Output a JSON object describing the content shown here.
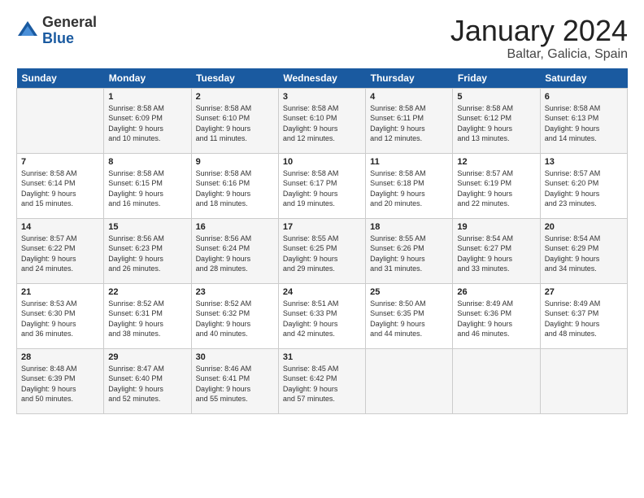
{
  "logo": {
    "general": "General",
    "blue": "Blue"
  },
  "title": "January 2024",
  "location": "Baltar, Galicia, Spain",
  "days_of_week": [
    "Sunday",
    "Monday",
    "Tuesday",
    "Wednesday",
    "Thursday",
    "Friday",
    "Saturday"
  ],
  "weeks": [
    [
      {
        "day": "",
        "info": ""
      },
      {
        "day": "1",
        "info": "Sunrise: 8:58 AM\nSunset: 6:09 PM\nDaylight: 9 hours\nand 10 minutes."
      },
      {
        "day": "2",
        "info": "Sunrise: 8:58 AM\nSunset: 6:10 PM\nDaylight: 9 hours\nand 11 minutes."
      },
      {
        "day": "3",
        "info": "Sunrise: 8:58 AM\nSunset: 6:10 PM\nDaylight: 9 hours\nand 12 minutes."
      },
      {
        "day": "4",
        "info": "Sunrise: 8:58 AM\nSunset: 6:11 PM\nDaylight: 9 hours\nand 12 minutes."
      },
      {
        "day": "5",
        "info": "Sunrise: 8:58 AM\nSunset: 6:12 PM\nDaylight: 9 hours\nand 13 minutes."
      },
      {
        "day": "6",
        "info": "Sunrise: 8:58 AM\nSunset: 6:13 PM\nDaylight: 9 hours\nand 14 minutes."
      }
    ],
    [
      {
        "day": "7",
        "info": "Sunrise: 8:58 AM\nSunset: 6:14 PM\nDaylight: 9 hours\nand 15 minutes."
      },
      {
        "day": "8",
        "info": "Sunrise: 8:58 AM\nSunset: 6:15 PM\nDaylight: 9 hours\nand 16 minutes."
      },
      {
        "day": "9",
        "info": "Sunrise: 8:58 AM\nSunset: 6:16 PM\nDaylight: 9 hours\nand 18 minutes."
      },
      {
        "day": "10",
        "info": "Sunrise: 8:58 AM\nSunset: 6:17 PM\nDaylight: 9 hours\nand 19 minutes."
      },
      {
        "day": "11",
        "info": "Sunrise: 8:58 AM\nSunset: 6:18 PM\nDaylight: 9 hours\nand 20 minutes."
      },
      {
        "day": "12",
        "info": "Sunrise: 8:57 AM\nSunset: 6:19 PM\nDaylight: 9 hours\nand 22 minutes."
      },
      {
        "day": "13",
        "info": "Sunrise: 8:57 AM\nSunset: 6:20 PM\nDaylight: 9 hours\nand 23 minutes."
      }
    ],
    [
      {
        "day": "14",
        "info": "Sunrise: 8:57 AM\nSunset: 6:22 PM\nDaylight: 9 hours\nand 24 minutes."
      },
      {
        "day": "15",
        "info": "Sunrise: 8:56 AM\nSunset: 6:23 PM\nDaylight: 9 hours\nand 26 minutes."
      },
      {
        "day": "16",
        "info": "Sunrise: 8:56 AM\nSunset: 6:24 PM\nDaylight: 9 hours\nand 28 minutes."
      },
      {
        "day": "17",
        "info": "Sunrise: 8:55 AM\nSunset: 6:25 PM\nDaylight: 9 hours\nand 29 minutes."
      },
      {
        "day": "18",
        "info": "Sunrise: 8:55 AM\nSunset: 6:26 PM\nDaylight: 9 hours\nand 31 minutes."
      },
      {
        "day": "19",
        "info": "Sunrise: 8:54 AM\nSunset: 6:27 PM\nDaylight: 9 hours\nand 33 minutes."
      },
      {
        "day": "20",
        "info": "Sunrise: 8:54 AM\nSunset: 6:29 PM\nDaylight: 9 hours\nand 34 minutes."
      }
    ],
    [
      {
        "day": "21",
        "info": "Sunrise: 8:53 AM\nSunset: 6:30 PM\nDaylight: 9 hours\nand 36 minutes."
      },
      {
        "day": "22",
        "info": "Sunrise: 8:52 AM\nSunset: 6:31 PM\nDaylight: 9 hours\nand 38 minutes."
      },
      {
        "day": "23",
        "info": "Sunrise: 8:52 AM\nSunset: 6:32 PM\nDaylight: 9 hours\nand 40 minutes."
      },
      {
        "day": "24",
        "info": "Sunrise: 8:51 AM\nSunset: 6:33 PM\nDaylight: 9 hours\nand 42 minutes."
      },
      {
        "day": "25",
        "info": "Sunrise: 8:50 AM\nSunset: 6:35 PM\nDaylight: 9 hours\nand 44 minutes."
      },
      {
        "day": "26",
        "info": "Sunrise: 8:49 AM\nSunset: 6:36 PM\nDaylight: 9 hours\nand 46 minutes."
      },
      {
        "day": "27",
        "info": "Sunrise: 8:49 AM\nSunset: 6:37 PM\nDaylight: 9 hours\nand 48 minutes."
      }
    ],
    [
      {
        "day": "28",
        "info": "Sunrise: 8:48 AM\nSunset: 6:39 PM\nDaylight: 9 hours\nand 50 minutes."
      },
      {
        "day": "29",
        "info": "Sunrise: 8:47 AM\nSunset: 6:40 PM\nDaylight: 9 hours\nand 52 minutes."
      },
      {
        "day": "30",
        "info": "Sunrise: 8:46 AM\nSunset: 6:41 PM\nDaylight: 9 hours\nand 55 minutes."
      },
      {
        "day": "31",
        "info": "Sunrise: 8:45 AM\nSunset: 6:42 PM\nDaylight: 9 hours\nand 57 minutes."
      },
      {
        "day": "",
        "info": ""
      },
      {
        "day": "",
        "info": ""
      },
      {
        "day": "",
        "info": ""
      }
    ]
  ]
}
